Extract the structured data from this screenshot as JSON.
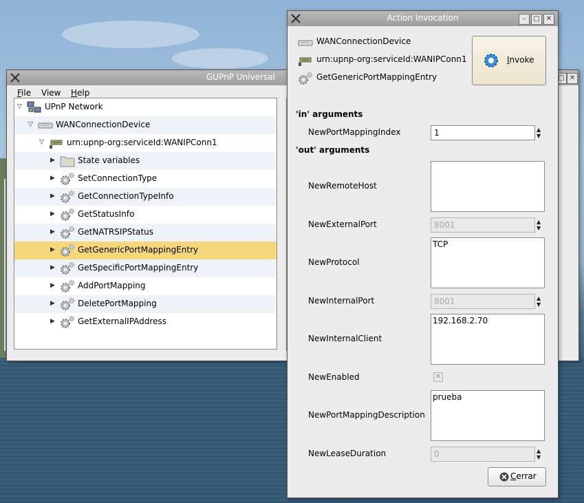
{
  "main_window": {
    "title": "GUPnP Universal",
    "menu": {
      "file": "File",
      "view": "View",
      "help": "Help"
    },
    "tree": [
      {
        "label": "UPnP Network",
        "icon": "network-icon"
      },
      {
        "label": "WANConnectionDevice",
        "icon": "device-icon"
      },
      {
        "label": "urn:upnp-org:serviceId:WANIPConn1",
        "icon": "service-icon"
      },
      {
        "label": "State variables",
        "icon": "folder-icon"
      },
      {
        "label": "SetConnectionType",
        "icon": "gear-icon"
      },
      {
        "label": "GetConnectionTypeInfo",
        "icon": "gear-icon"
      },
      {
        "label": "GetStatusInfo",
        "icon": "gear-icon"
      },
      {
        "label": "GetNATRSIPStatus",
        "icon": "gear-icon"
      },
      {
        "label": "GetGenericPortMappingEntry",
        "icon": "gear-icon",
        "selected": true
      },
      {
        "label": "GetSpecificPortMappingEntry",
        "icon": "gear-icon"
      },
      {
        "label": "AddPortMapping",
        "icon": "gear-icon"
      },
      {
        "label": "DeletePortMapping",
        "icon": "gear-icon"
      },
      {
        "label": "GetExternalIPAddress",
        "icon": "gear-icon"
      }
    ]
  },
  "dialog": {
    "title": "Action Invocation",
    "device": "WANConnectionDevice",
    "service": "urn:upnp-org:serviceId:WANIPConn1",
    "action": "GetGenericPortMappingEntry",
    "invoke_label_first": "I",
    "invoke_label_rest": "nvoke",
    "in_heading": "'in' arguments",
    "out_heading": "'out' arguments",
    "in_args": [
      {
        "name": "NewPortMappingIndex",
        "value": "1"
      }
    ],
    "out_args": [
      {
        "name": "NewRemoteHost",
        "value": ""
      },
      {
        "name": "NewExternalPort",
        "value": "8001"
      },
      {
        "name": "NewProtocol",
        "value": "TCP"
      },
      {
        "name": "NewInternalPort",
        "value": "8001"
      },
      {
        "name": "NewInternalClient",
        "value": "192.168.2.70"
      },
      {
        "name": "NewEnabled",
        "value": "checked"
      },
      {
        "name": "NewPortMappingDescription",
        "value": "prueba"
      },
      {
        "name": "NewLeaseDuration",
        "value": "0"
      }
    ],
    "close_label_first": "C",
    "close_label_rest": "errar"
  },
  "colors": {
    "selection": "#f7d77c",
    "alt_row": "#eef3fa",
    "titlebar": "#a8a8a8"
  }
}
